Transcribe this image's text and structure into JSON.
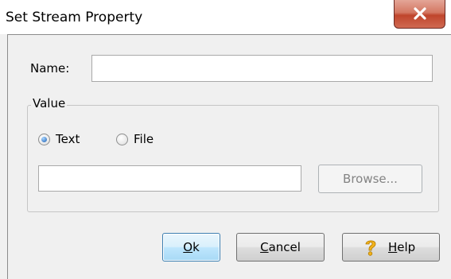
{
  "window": {
    "title": "Set Stream Property"
  },
  "form": {
    "name_label": "Name:",
    "name_value": "",
    "value_group_label": "Value",
    "radio_text_label": "Text",
    "radio_file_label": "File",
    "selected": "Text",
    "value_field_value": "",
    "browse_label": "Browse..."
  },
  "buttons": {
    "ok_mnemonic": "O",
    "ok_rest": "k",
    "cancel_mnemonic": "C",
    "cancel_rest": "ancel",
    "help_mnemonic": "H",
    "help_rest": "elp"
  },
  "icons": {
    "close": "close-icon",
    "help": "question-mark-icon"
  },
  "colors": {
    "close_button": "#c7452d",
    "default_button_border": "#3c7fb1",
    "radio_selected": "#1d5fb3"
  }
}
